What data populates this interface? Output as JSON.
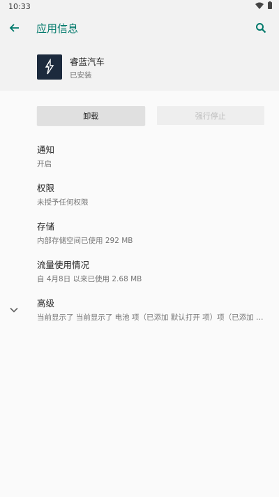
{
  "status_bar": {
    "time": "10:33",
    "icons": [
      "wifi-icon",
      "battery-icon"
    ]
  },
  "app_bar": {
    "title": "应用信息",
    "back_icon": "arrow-back-icon",
    "search_icon": "search-icon"
  },
  "app": {
    "name": "睿蓝汽车",
    "status": "已安装"
  },
  "buttons": {
    "uninstall": "卸载",
    "force_stop": "强行停止"
  },
  "items": [
    {
      "title": "通知",
      "subtitle": "开启"
    },
    {
      "title": "权限",
      "subtitle": "未授予任何权限"
    },
    {
      "title": "存储",
      "subtitle": "内部存储空间已使用 292 MB"
    },
    {
      "title": "流量使用情况",
      "subtitle": "自 4月8日 以来已使用 2.68 MB"
    },
    {
      "title": "高级",
      "subtitle": "当前显示了 当前显示了 电池 项（已添加 默认打开 项）项（已添加 高级…"
    }
  ],
  "colors": {
    "accent": "#00796b",
    "icon_bg": "#1c2a3d"
  }
}
